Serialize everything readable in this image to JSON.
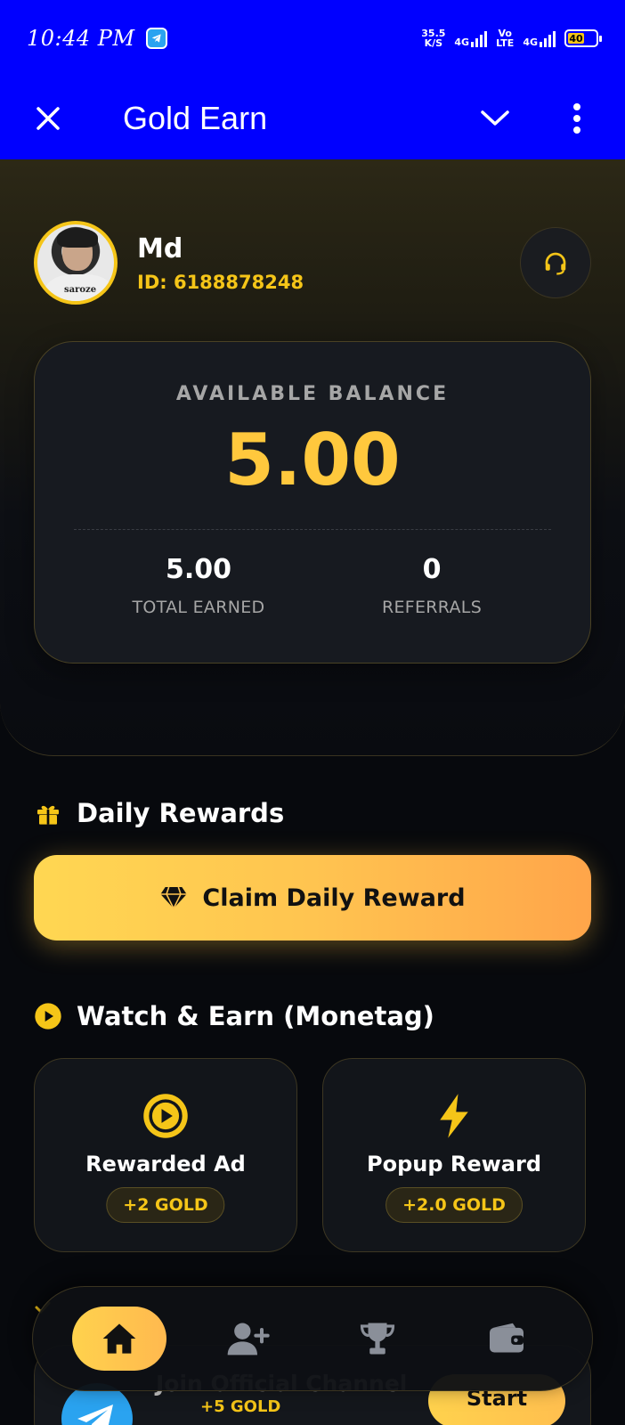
{
  "status_bar": {
    "time": "10:44 PM",
    "net_speed_top": "35.5",
    "net_speed_bottom": "K/S",
    "sim1_label": "4G",
    "volte_top": "Vo",
    "volte_bottom": "LTE",
    "sim2_label": "4G",
    "battery_level": "40"
  },
  "app_bar": {
    "title": "Gold Earn"
  },
  "profile": {
    "name": "Md",
    "id_text": "ID: 6188878248",
    "avatar_text": "saroze"
  },
  "balance": {
    "label": "AVAILABLE BALANCE",
    "value": "5.00",
    "total_earned_value": "5.00",
    "total_earned_label": "TOTAL EARNED",
    "referrals_value": "0",
    "referrals_label": "REFERRALS"
  },
  "daily_rewards": {
    "title": "Daily Rewards",
    "claim_label": "Claim Daily Reward"
  },
  "watch_earn": {
    "title": "Watch & Earn (Monetag)",
    "cards": [
      {
        "name": "Rewarded Ad",
        "reward": "+2 GOLD",
        "icon": "play-circle-icon"
      },
      {
        "name": "Popup Reward",
        "reward": "+2.0 GOLD",
        "icon": "lightning-icon"
      }
    ]
  },
  "tasks": {
    "item_title": "Join Official Channel",
    "item_reward": "+5 GOLD",
    "start_label": "Start"
  },
  "bottom_nav": {
    "items": [
      "home-icon",
      "add-user-icon",
      "trophy-icon",
      "wallet-icon"
    ],
    "active": 0
  },
  "colors": {
    "accent": "#f5c518",
    "balance": "#ffc83d",
    "app_bar": "#0000ff"
  }
}
